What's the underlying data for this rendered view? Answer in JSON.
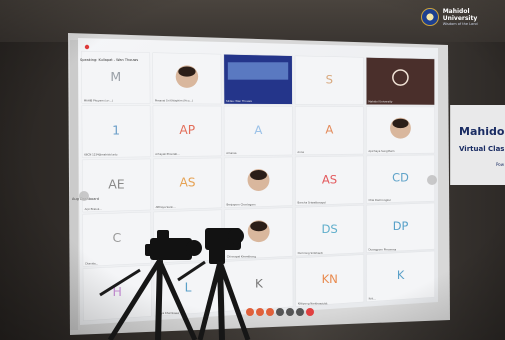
{
  "watermark": {
    "title": "Mahidol University",
    "subtitle": "Wisdom of the Land"
  },
  "banner": {
    "line1": "Mahidol",
    "line2": "Virtual Clas",
    "line3": "Pow"
  },
  "meeting": {
    "active_speaker": "Speaking: Kullapat - Wan Thouws",
    "tiles": [
      {
        "initial": "M",
        "color": "#9aa1a8",
        "name": "MAHIB Phuyam (co-...)"
      },
      {
        "initial": "",
        "color": "#c8c8c8",
        "name": "Pimanai Sri Khlaphim (Hcu...)",
        "photo": true
      },
      {
        "initial": "",
        "color": "#2b3a8f",
        "name": "Slides: Wan Thouws",
        "slide": true
      },
      {
        "initial": "S",
        "color": "#d8a87d",
        "name": ""
      },
      {
        "initial": "",
        "color": "#5a3a32",
        "name": "Mahidol University",
        "podcast": true
      },
      {
        "initial": "1",
        "color": "#6b9ec8",
        "name": "66CN 1234@mahidol.edu"
      },
      {
        "initial": "AP",
        "color": "#e36e5a",
        "name": "Arhayali Phonlati..."
      },
      {
        "initial": "A",
        "color": "#9cc2e8",
        "name": "Amaraa"
      },
      {
        "initial": "A",
        "color": "#e48d5e",
        "name": "Anna"
      },
      {
        "initial": "",
        "color": "#c8c8c8",
        "name": "Apichaya Sungtham",
        "photo": true
      },
      {
        "initial": "AE",
        "color": "#8a8a8a",
        "name": "Arpi Ekaluk..."
      },
      {
        "initial": "AS",
        "color": "#e6a253",
        "name": "Atthaya Sarin..."
      },
      {
        "initial": "",
        "color": "#c8c8c8",
        "name": "Benjaporn Chonlagarn",
        "photo": true
      },
      {
        "initial": "AS",
        "color": "#e3595d",
        "name": "Bancha Sriwattanapol"
      },
      {
        "initial": "CD",
        "color": "#5fa3c9",
        "name": "Chai Damrongkul"
      },
      {
        "initial": "C",
        "color": "#9a9a9a",
        "name": "Chanida..."
      },
      {
        "initial": "",
        "color": "#c8c8c8",
        "name": "",
        "blank": true
      },
      {
        "initial": "",
        "color": "#c8c8c8",
        "name": "Chinnapat Khemthong",
        "photo": true
      },
      {
        "initial": "DS",
        "color": "#5faecb",
        "name": "Dumrong Sirikhanti"
      },
      {
        "initial": "DP",
        "color": "#56a0c8",
        "name": "Duangporn Phromma"
      },
      {
        "initial": "H",
        "color": "#c78fd6",
        "name": ""
      },
      {
        "initial": "L",
        "color": "#5aa0c8",
        "name": "Kanya Khamkaew"
      },
      {
        "initial": "K",
        "color": "#777777",
        "name": ""
      },
      {
        "initial": "KN",
        "color": "#e88a4e",
        "name": "Kittipong Nanthawichit"
      },
      {
        "initial": "K",
        "color": "#5aa0c8",
        "name": "Krit..."
      }
    ],
    "left_partial": [
      "Aug Dashboard"
    ],
    "controls": [
      "mute-icon",
      "video-icon",
      "share-icon",
      "chat-icon",
      "participants-icon",
      "reactions-icon",
      "end-call-icon"
    ]
  }
}
